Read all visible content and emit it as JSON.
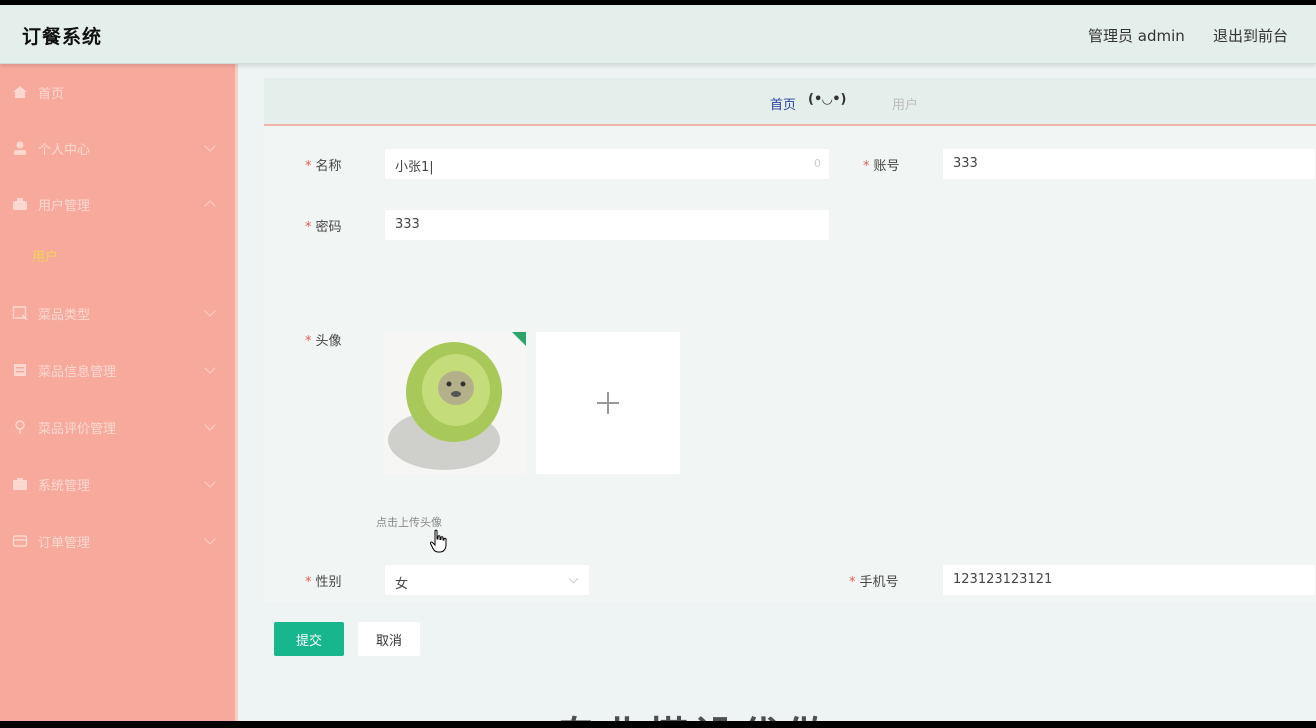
{
  "header": {
    "app_title": "订餐系统",
    "admin_label": "管理员 admin",
    "logout_label": "退出到前台"
  },
  "sidebar": {
    "items": [
      {
        "label": "首页",
        "icon": "home-icon",
        "expanded": false,
        "has_chevron": false
      },
      {
        "label": "个人中心",
        "icon": "user-icon",
        "expanded": false,
        "has_chevron": true
      },
      {
        "label": "用户管理",
        "icon": "users-icon",
        "expanded": true,
        "has_chevron": true
      },
      {
        "label": "菜品类型",
        "icon": "tag-icon",
        "expanded": false,
        "has_chevron": true
      },
      {
        "label": "菜品信息管理",
        "icon": "menu-icon",
        "expanded": false,
        "has_chevron": true
      },
      {
        "label": "菜品评价管理",
        "icon": "comment-icon",
        "expanded": false,
        "has_chevron": true
      },
      {
        "label": "系统管理",
        "icon": "settings-icon",
        "expanded": false,
        "has_chevron": true
      },
      {
        "label": "订单管理",
        "icon": "order-icon",
        "expanded": false,
        "has_chevron": true
      }
    ],
    "sub_item": {
      "label": "用户"
    }
  },
  "breadcrumb": {
    "home": "首页",
    "face": "(•◡•)",
    "current": "用户"
  },
  "form": {
    "name": {
      "label": "名称",
      "value": "小张1|",
      "counter": "0"
    },
    "account": {
      "label": "账号",
      "value": "333"
    },
    "password": {
      "label": "密码",
      "value": "333"
    },
    "avatar": {
      "label": "头像",
      "hint": "点击上传头像"
    },
    "gender": {
      "label": "性别",
      "value": "女"
    },
    "phone": {
      "label": "手机号",
      "value": "123123123121"
    },
    "submit_label": "提交",
    "cancel_label": "取消"
  },
  "footer_text": "专业搭设代做",
  "colors": {
    "topbar": "#e4efec",
    "sidebar": "#f7a99c",
    "submit": "#17b68c",
    "active_sub": "#f3d35a"
  }
}
